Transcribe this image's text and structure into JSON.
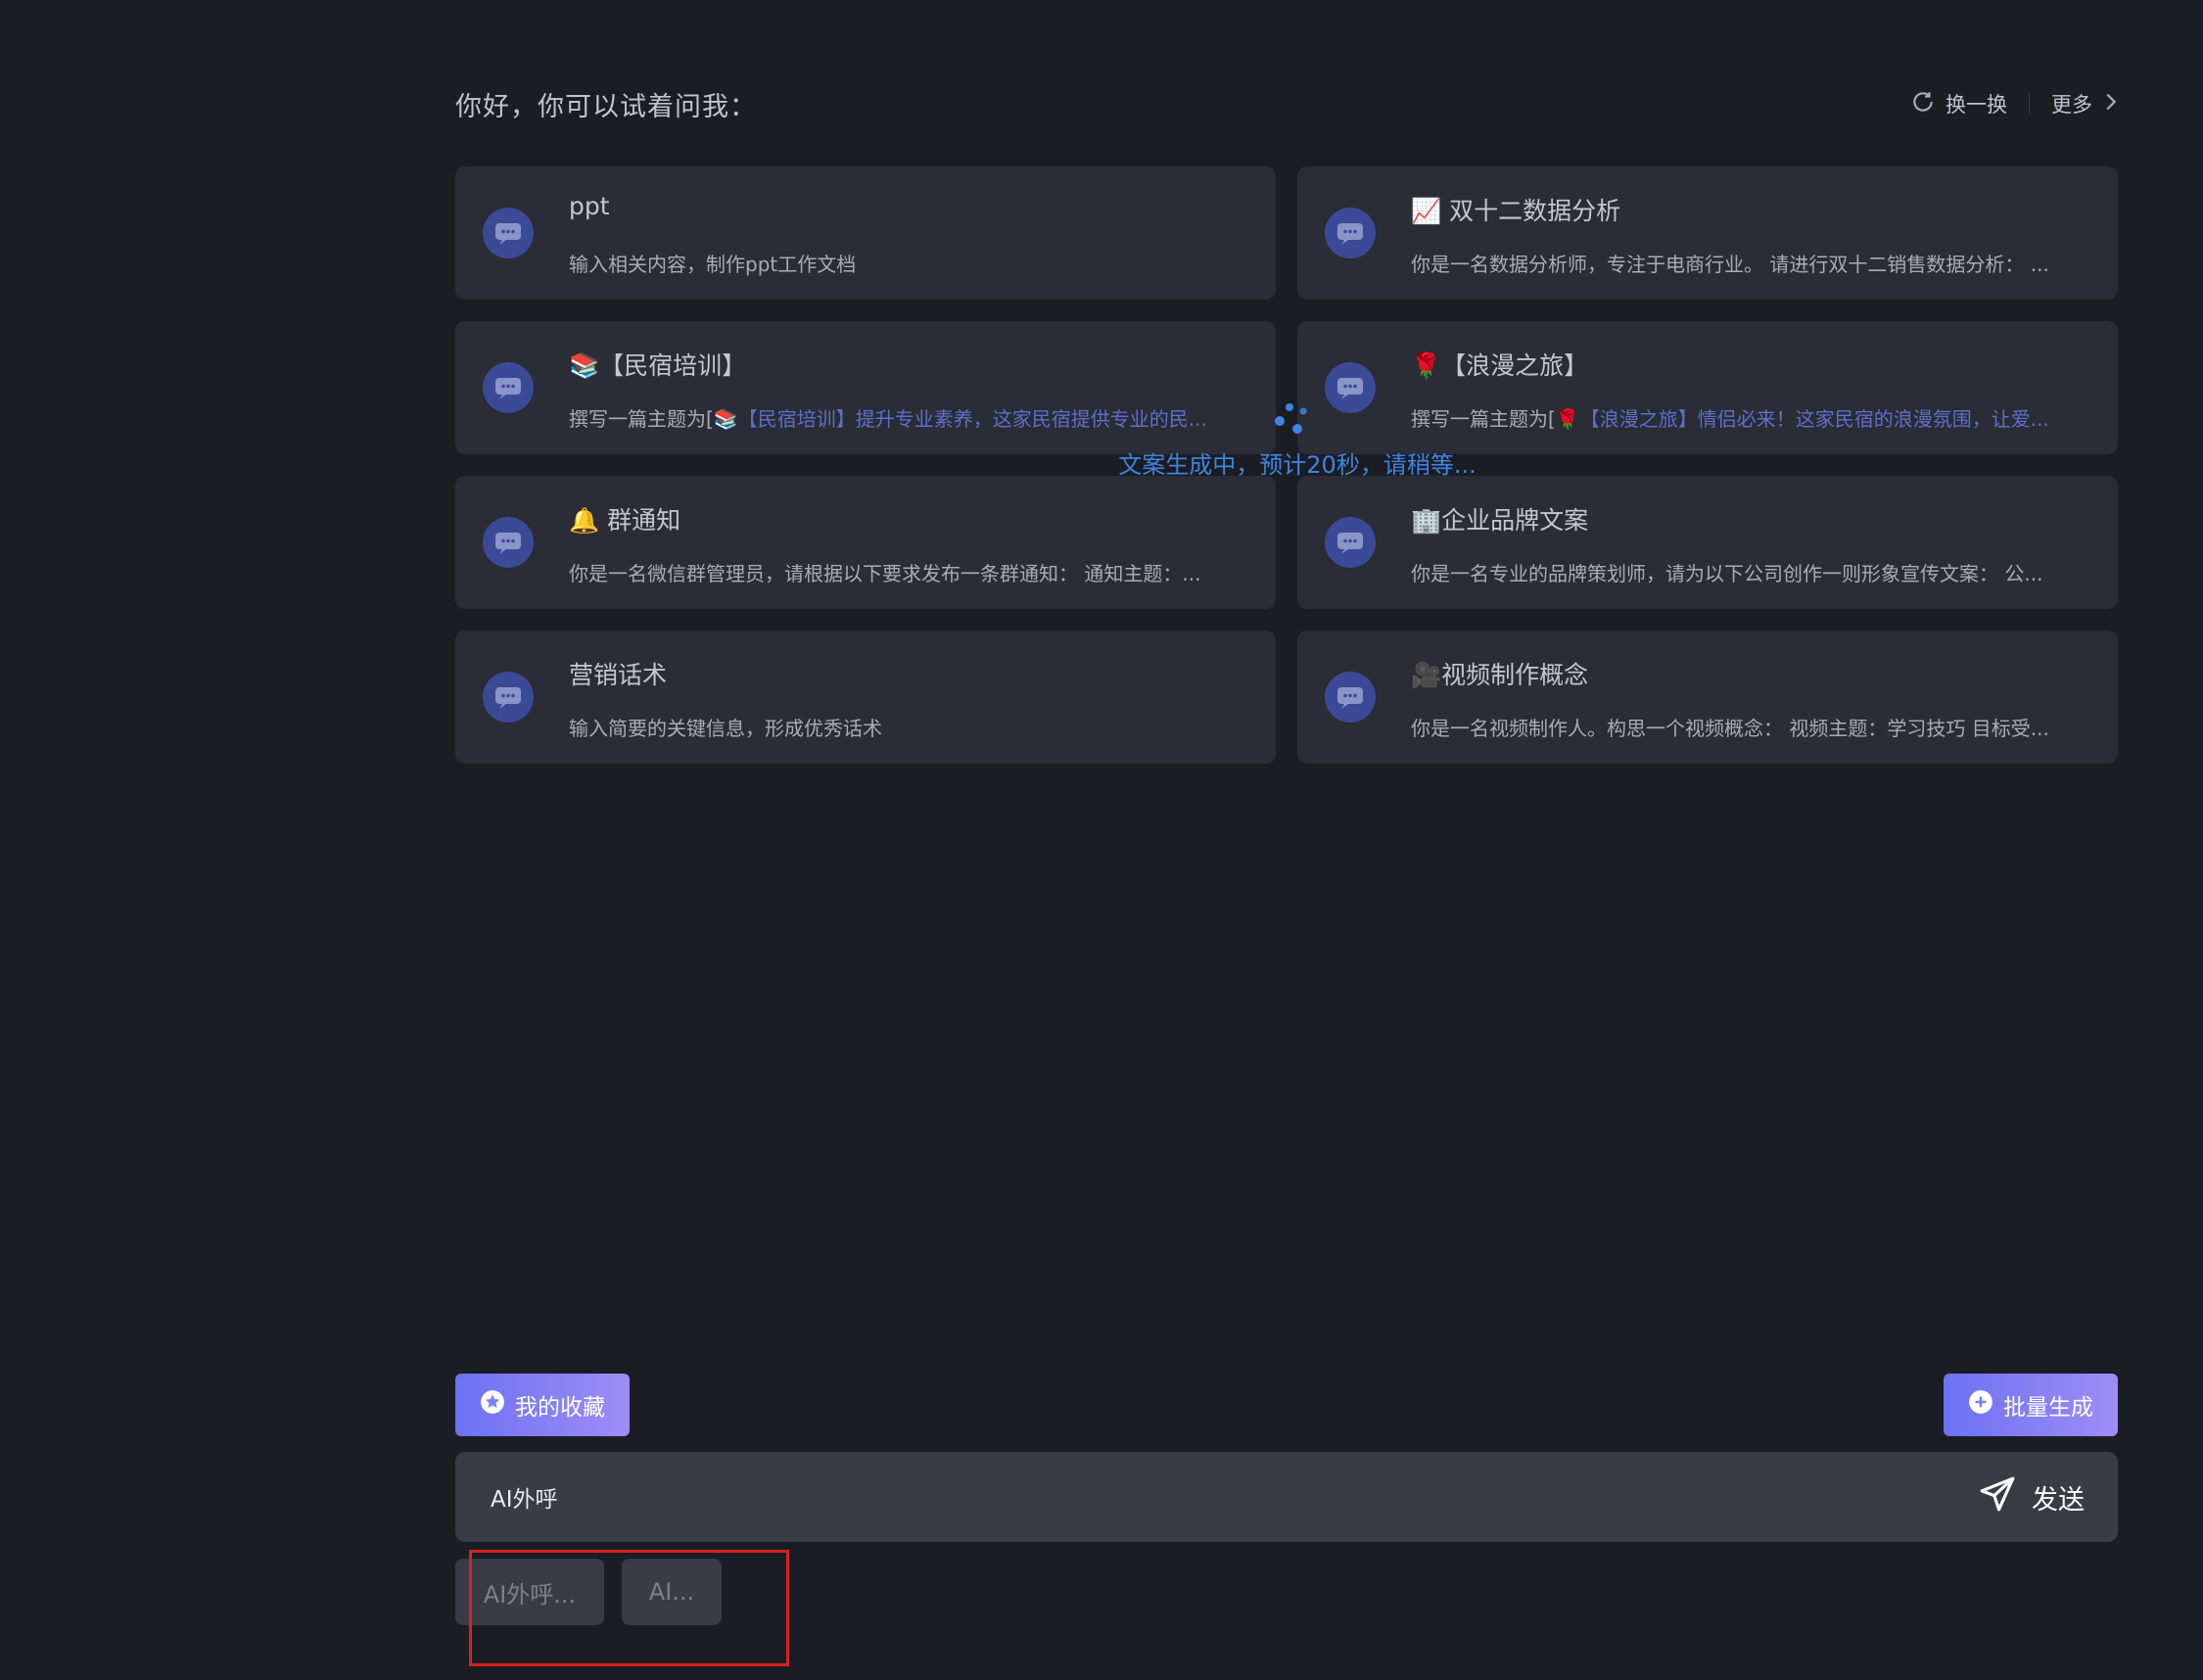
{
  "header": {
    "greeting": "你好，你可以试着问我：",
    "refresh_label": "换一换",
    "more_label": "更多"
  },
  "cards": [
    {
      "title": "ppt",
      "desc": "输入相关内容，制作ppt工作文档"
    },
    {
      "title": "📈 双十二数据分析",
      "desc": "你是一名数据分析师，专注于电商行业。 请进行双十二销售数据分析： ..."
    },
    {
      "title": "📚【民宿培训】",
      "desc_prefix": "撰写一篇主题为[",
      "desc_highlight": "📚【民宿培训】提升专业素养，这家民宿提供专业的民..."
    },
    {
      "title": "🌹【浪漫之旅】",
      "desc_prefix": "撰写一篇主题为[",
      "desc_highlight": "🌹【浪漫之旅】情侣必来！这家民宿的浪漫氛围，让爱..."
    },
    {
      "title": "🔔 群通知",
      "desc": "你是一名微信群管理员，请根据以下要求发布一条群通知： 通知主题：..."
    },
    {
      "title": "🏢企业品牌文案",
      "desc": "你是一名专业的品牌策划师，请为以下公司创作一则形象宣传文案： 公..."
    },
    {
      "title": "营销话术",
      "desc": "输入简要的关键信息，形成优秀话术"
    },
    {
      "title": "🎥视频制作概念",
      "desc": "你是一名视频制作人。构思一个视频概念： 视频主题：学习技巧 目标受..."
    }
  ],
  "loading_text": "文案生成中，预计20秒，请稍等...",
  "favorites_label": "我的收藏",
  "batch_label": "批量生成",
  "input": {
    "value": "AI外呼"
  },
  "send_label": "发送",
  "suggestions": [
    "AI外呼...",
    "AI..."
  ],
  "colors": {
    "accent_start": "#6b72f2",
    "accent_end": "#9f8cf6",
    "loading": "#3f84e0",
    "highlight_box": "#d82222"
  }
}
